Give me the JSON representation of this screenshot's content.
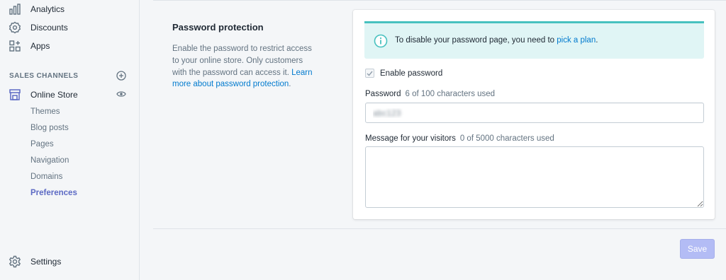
{
  "sidebar": {
    "items": [
      {
        "label": "Analytics",
        "icon": "analytics-icon"
      },
      {
        "label": "Discounts",
        "icon": "discount-icon"
      },
      {
        "label": "Apps",
        "icon": "apps-icon"
      }
    ],
    "sales_channels_title": "SALES CHANNELS",
    "online_store": {
      "label": "Online Store",
      "icon": "store-icon"
    },
    "sub_items": [
      "Themes",
      "Blog posts",
      "Pages",
      "Navigation",
      "Domains",
      "Preferences"
    ],
    "active_sub_item": "Preferences",
    "settings": {
      "label": "Settings",
      "icon": "gear-icon"
    }
  },
  "section": {
    "title": "Password protection",
    "description": "Enable the password to restrict access to your online store. Only customers with the password can access it.",
    "learn_more_link": "Learn more about password protection",
    "learn_more_suffix": "."
  },
  "banner": {
    "text": "To disable your password page, you need to",
    "link": "pick a plan",
    "suffix": ".",
    "icon": "info-icon"
  },
  "form": {
    "enable_password_label": "Enable password",
    "enable_password_checked": true,
    "password_label": "Password",
    "password_count": "6 of 100 characters used",
    "password_value": "abc123",
    "message_label": "Message for your visitors",
    "message_count": "0 of 5000 characters used",
    "message_value": ""
  },
  "actions": {
    "save_label": "Save"
  },
  "colors": {
    "accent": "#5c6ac4",
    "link": "#007ace",
    "banner_bg": "#e0f5f5",
    "banner_border": "#47c1bf",
    "save_disabled": "#b3bcf5"
  }
}
